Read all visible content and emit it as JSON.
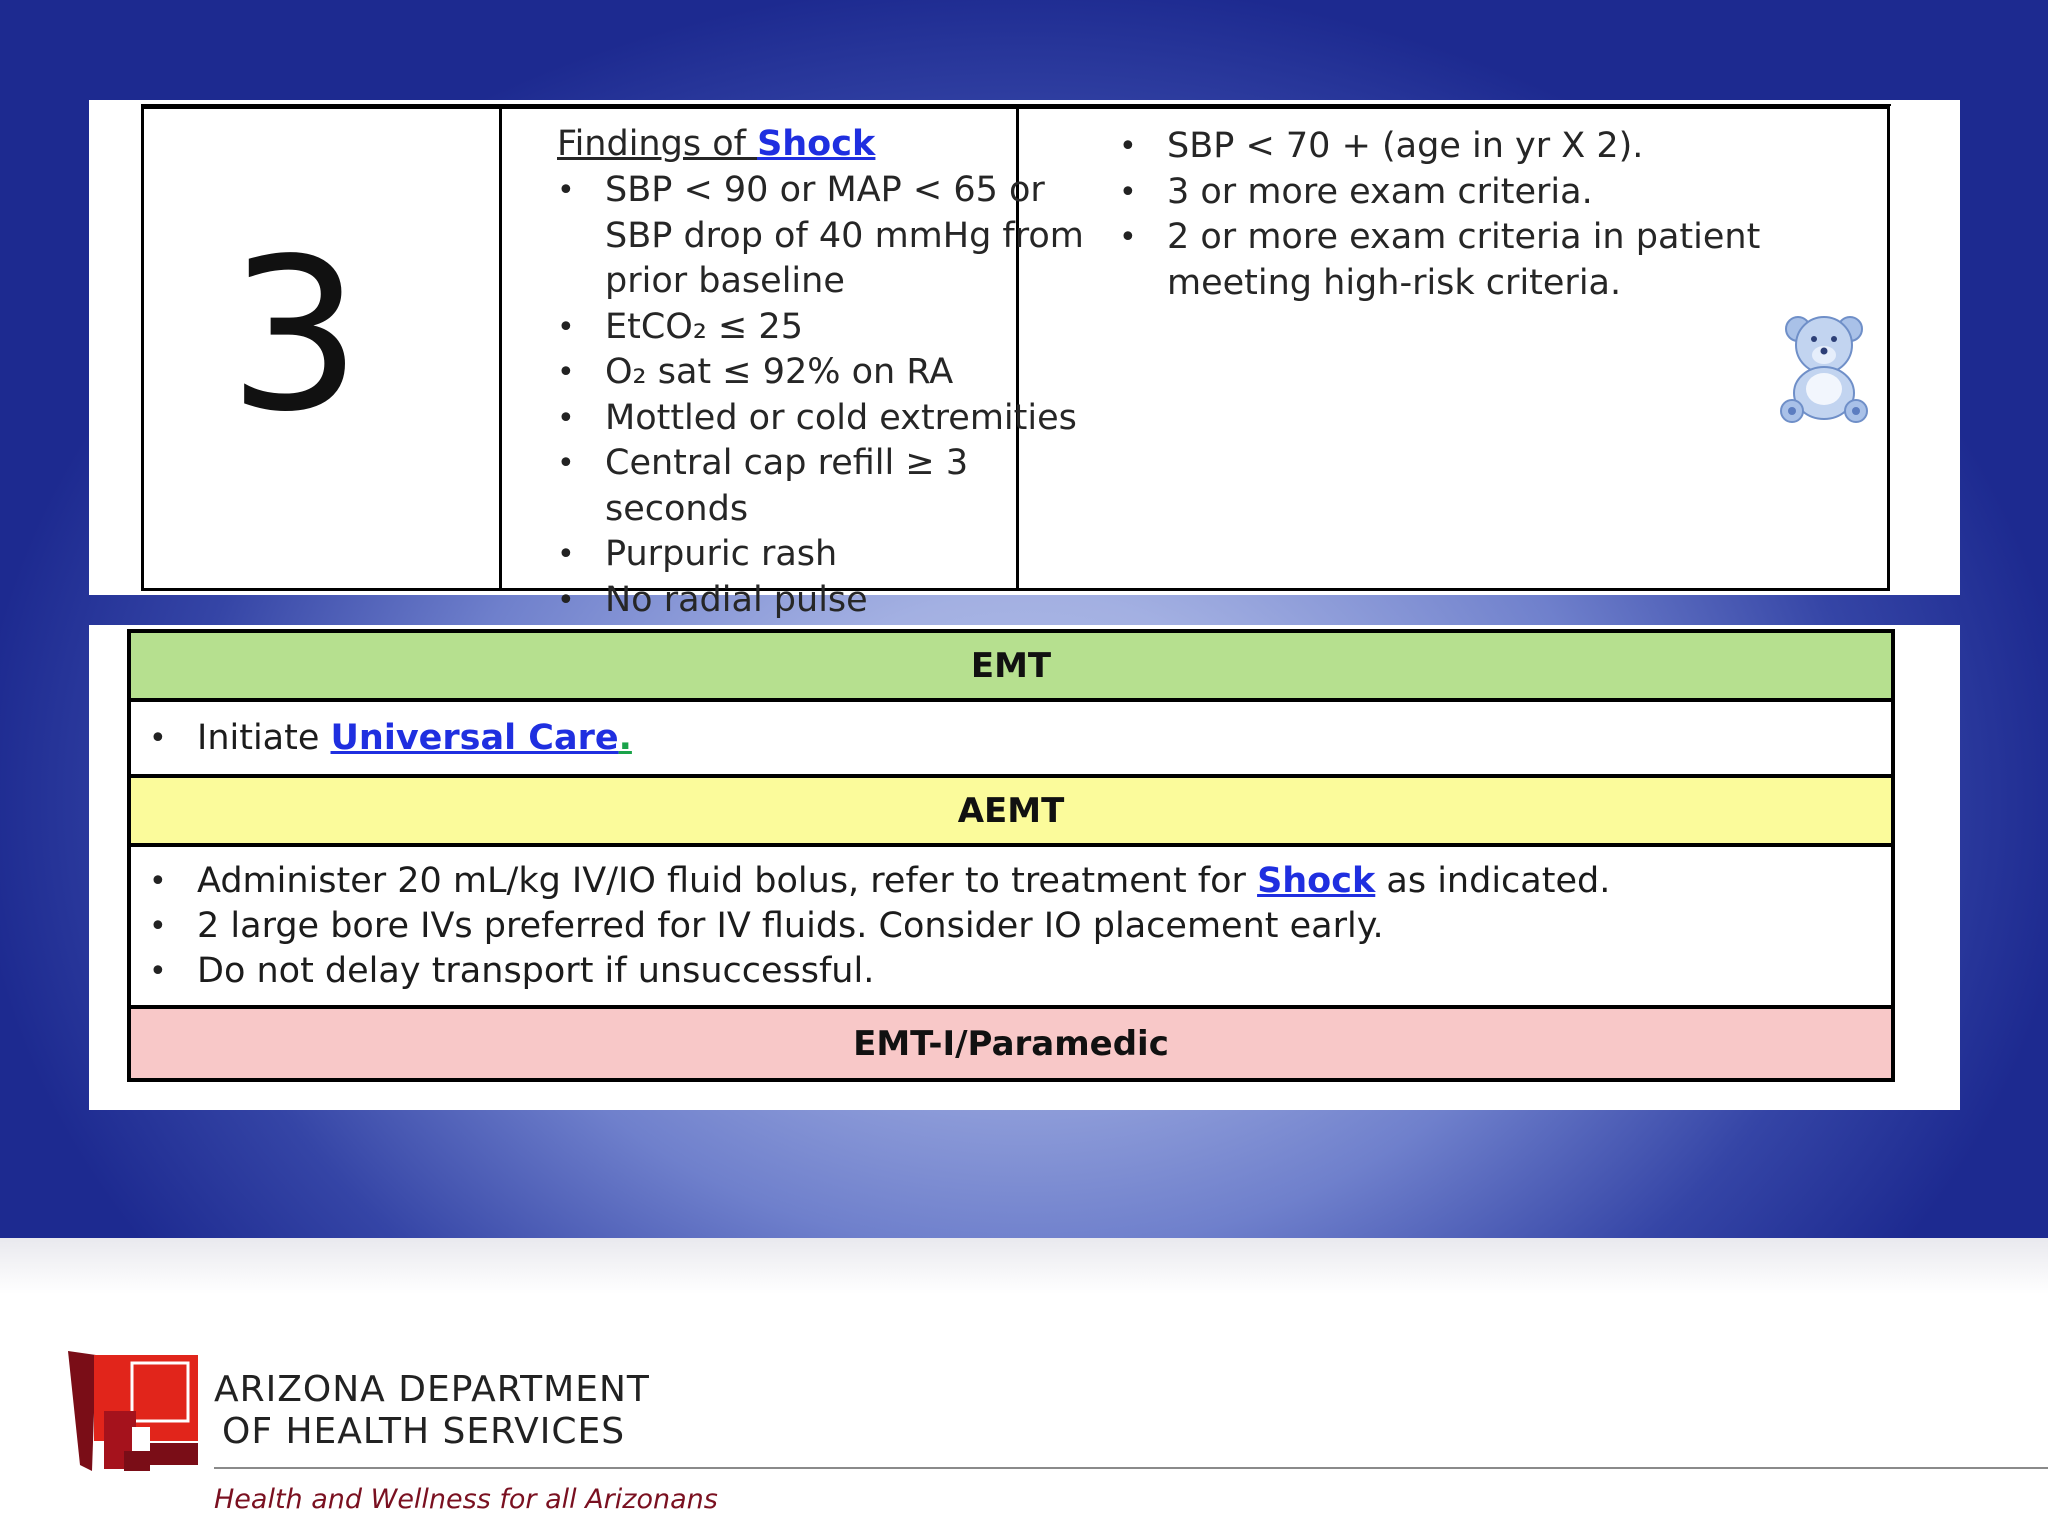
{
  "level": {
    "number": "3",
    "findings_title_prefix": "Findings of ",
    "findings_title_link": "Shock",
    "findings": [
      "SBP < 90 or MAP < 65 or SBP drop of 40 mmHg from prior baseline",
      "EtCO₂ ≤ 25",
      "O₂ sat ≤ 92% on RA",
      "Mottled or cold extremities",
      "Central cap refill ≥ 3 seconds",
      "Purpuric rash",
      "No radial pulse"
    ],
    "criteria": [
      "SBP < 70 + (age in yr X 2).",
      "3 or more exam criteria.",
      "2 or more exam criteria in patient meeting high-risk criteria."
    ]
  },
  "providers": {
    "emt": {
      "header": "EMT",
      "item_prefix": "Initiate ",
      "item_link": "Universal Care",
      "item_suffix": "."
    },
    "aemt": {
      "header": "AEMT",
      "item1_prefix": "Administer 20 mL/kg IV/IO fluid bolus, refer to treatment for ",
      "item1_link": "Shock",
      "item1_suffix": " as indicated.",
      "item2": "2 large bore IVs preferred for IV fluids.  Consider IO placement early.",
      "item3": "Do not delay transport if unsuccessful."
    },
    "paramedic": {
      "header": "EMT-I/Paramedic"
    }
  },
  "footer": {
    "org_line1": "ARIZONA DEPARTMENT",
    "org_line2": "OF HEALTH SERVICES",
    "tagline": "Health and Wellness for all Arizonans"
  },
  "colors": {
    "emt_header": "#b6e08f",
    "aemt_header": "#fbfb9b",
    "paramedic_header": "#f8c8c8",
    "link": "#1f2fe0",
    "tagline": "#7a1020"
  }
}
